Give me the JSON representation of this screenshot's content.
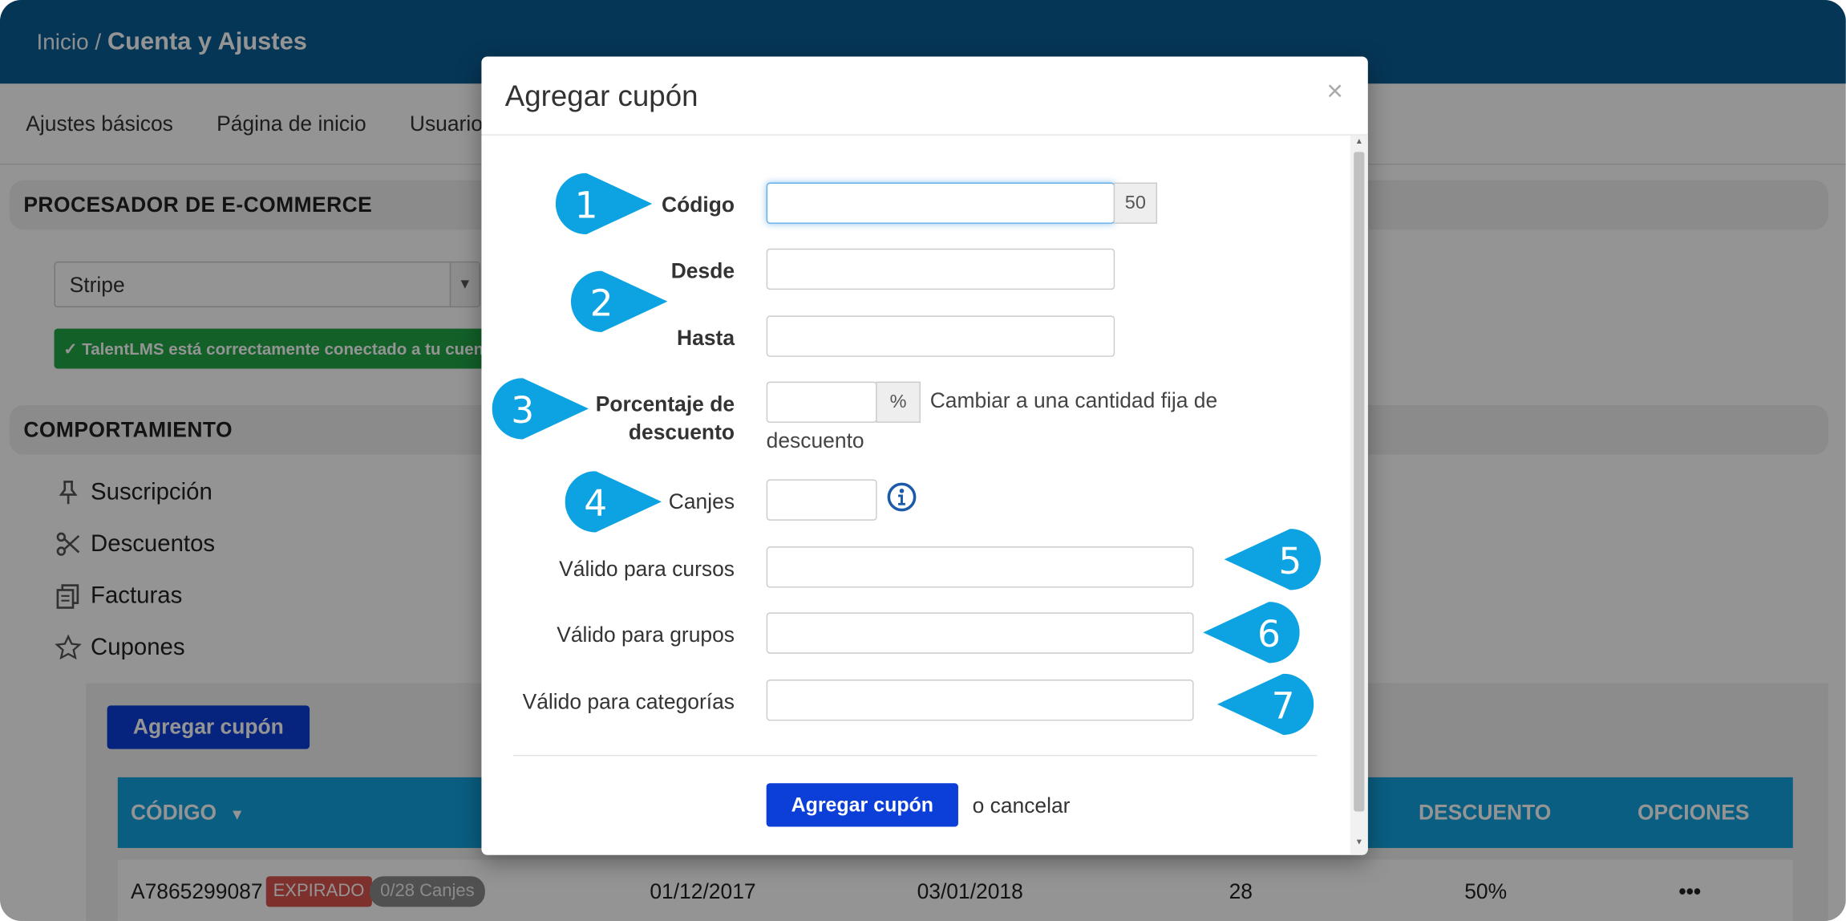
{
  "header": {
    "breadcrumb_home": "Inicio /",
    "breadcrumb_current": "Cuenta y Ajustes"
  },
  "tabs": [
    "Ajustes básicos",
    "Página de inicio",
    "Usuario"
  ],
  "ecommerce": {
    "section_title": "PROCESADOR DE E-COMMERCE",
    "processor_value": "Stripe",
    "success_message": "✓ TalentLMS está correctamente conectado a tu cuenta"
  },
  "behavior": {
    "section_title": "COMPORTAMIENTO",
    "items": [
      {
        "label": "Suscripción",
        "icon": "pin-icon"
      },
      {
        "label": "Descuentos",
        "icon": "scissors-icon"
      },
      {
        "label": "Facturas",
        "icon": "invoice-icon"
      },
      {
        "label": "Cupones",
        "icon": "star-icon"
      }
    ]
  },
  "coupons": {
    "add_button": "Agregar cupón",
    "columns": {
      "code": "CÓDIGO",
      "discount": "DESCUENTO",
      "options": "OPCIONES"
    },
    "rows": [
      {
        "code": "A7865299087",
        "status": "EXPIRADO",
        "redemptions": "0/28 Canjes",
        "from": "01/12/2017",
        "to": "03/01/2018",
        "count": "28",
        "discount": "50%",
        "options": "•••"
      }
    ]
  },
  "modal": {
    "title": "Agregar cupón",
    "close": "×",
    "fields": {
      "code_label": "Código",
      "code_value": "",
      "code_maxlength": "50",
      "from_label": "Desde",
      "from_value": "",
      "to_label": "Hasta",
      "to_value": "",
      "percent_label_line1": "Porcentaje de",
      "percent_label_line2": "descuento",
      "percent_value": "",
      "percent_addon": "%",
      "switch_fixed_line1": "Cambiar a una cantidad fija de",
      "switch_fixed_line2": "descuento",
      "redemptions_label": "Canjes",
      "redemptions_value": "",
      "courses_label": "Válido para cursos",
      "courses_value": "",
      "groups_label": "Válido para grupos",
      "groups_value": "",
      "categories_label": "Válido para categorías",
      "categories_value": ""
    },
    "submit": "Agregar cupón",
    "cancel": "o cancelar"
  },
  "callouts": [
    "1",
    "2",
    "3",
    "4",
    "5",
    "6",
    "7"
  ],
  "colors": {
    "header_blue": "#0c5d94",
    "callout_blue": "#0da3e2",
    "primary_button": "#0b3fd8",
    "table_header": "#12a3df",
    "success_green": "#22a548",
    "expired_red": "#d9534f"
  }
}
